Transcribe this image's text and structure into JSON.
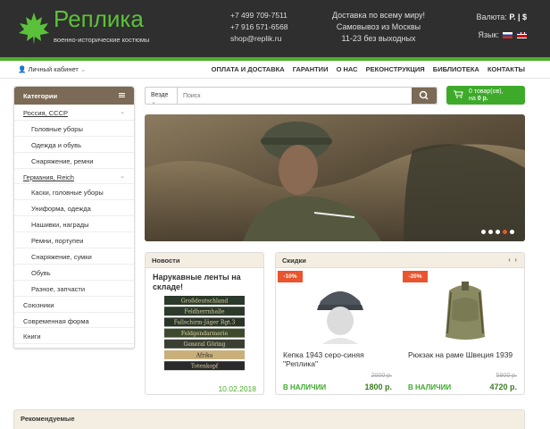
{
  "header": {
    "logo_title": "Реплика",
    "logo_subtitle": "военно-исторические костюмы",
    "phones": [
      "+7 499 709-7511",
      "+7 916 571-6568",
      "shop@replik.ru"
    ],
    "delivery": [
      "Доставка по всему миру!",
      "Самовывоз из Москвы",
      "11-23 без выходных"
    ],
    "currency_label": "Валюта:",
    "currency_options": "Р. | $",
    "language_label": "Язык:",
    "languages": [
      "ru",
      "en"
    ],
    "accent_color": "#4cae2b",
    "brown_color": "#7b6a55"
  },
  "topbar": {
    "account": "Личный кабинет",
    "nav": [
      "ОПЛАТА И ДОСТАВКА",
      "ГАРАНТИИ",
      "О НАС",
      "РЕКОНСТРУКЦИЯ",
      "БИБЛИОТЕКА",
      "КОНТАКТЫ"
    ]
  },
  "categories": {
    "title": "Категории",
    "items": [
      {
        "label": "Россия, СССР",
        "type": "main",
        "expand": true
      },
      {
        "label": "Головные уборы",
        "type": "sub"
      },
      {
        "label": "Одежда и обувь",
        "type": "sub"
      },
      {
        "label": "Снаряжение, ремни",
        "type": "sub"
      },
      {
        "label": "Германия, Reich",
        "type": "main",
        "expand": true
      },
      {
        "label": "Каски, головные уборы",
        "type": "sub"
      },
      {
        "label": "Униформа, одежда",
        "type": "sub"
      },
      {
        "label": "Нашивки, награды",
        "type": "sub"
      },
      {
        "label": "Ремни, портупеи",
        "type": "sub"
      },
      {
        "label": "Снаряжение, сумки",
        "type": "sub"
      },
      {
        "label": "Обувь",
        "type": "sub"
      },
      {
        "label": "Разное, запчасти",
        "type": "sub"
      },
      {
        "label": "Союзники",
        "type": "top"
      },
      {
        "label": "Современная форма",
        "type": "top"
      },
      {
        "label": "Книги",
        "type": "top"
      }
    ]
  },
  "search": {
    "scope": "Везде",
    "placeholder": "Поиск"
  },
  "cart": {
    "line1": "0 товар(ов),",
    "line2_prefix": "на",
    "amount": "0 р."
  },
  "banner": {
    "slides": 5,
    "active_slide": 4
  },
  "news": {
    "title": "Новости",
    "item_title": "Нарукавные ленты на складе!",
    "band_texts": [
      "Großdeutschland",
      "Feldherrnhalle",
      "Fallschirm-Jäger Rgt.3",
      "Feldgendarmerie",
      "General Göring",
      "Afrika",
      "Totenkopf"
    ],
    "date": "10.02.2018"
  },
  "sales": {
    "title": "Скидки",
    "products": [
      {
        "badge": "-10%",
        "name": "Кепка 1943 серо-синяя \"Реплика\"",
        "old_price": "2000 р.",
        "stock": "В НАЛИЧИИ",
        "price": "1800 р."
      },
      {
        "badge": "-20%",
        "name": "Рюкзак на раме Швеция 1939",
        "old_price": "5900 р.",
        "stock": "В НАЛИЧИИ",
        "price": "4720 р."
      }
    ]
  },
  "recommended": {
    "title": "Рекомендуемые"
  }
}
